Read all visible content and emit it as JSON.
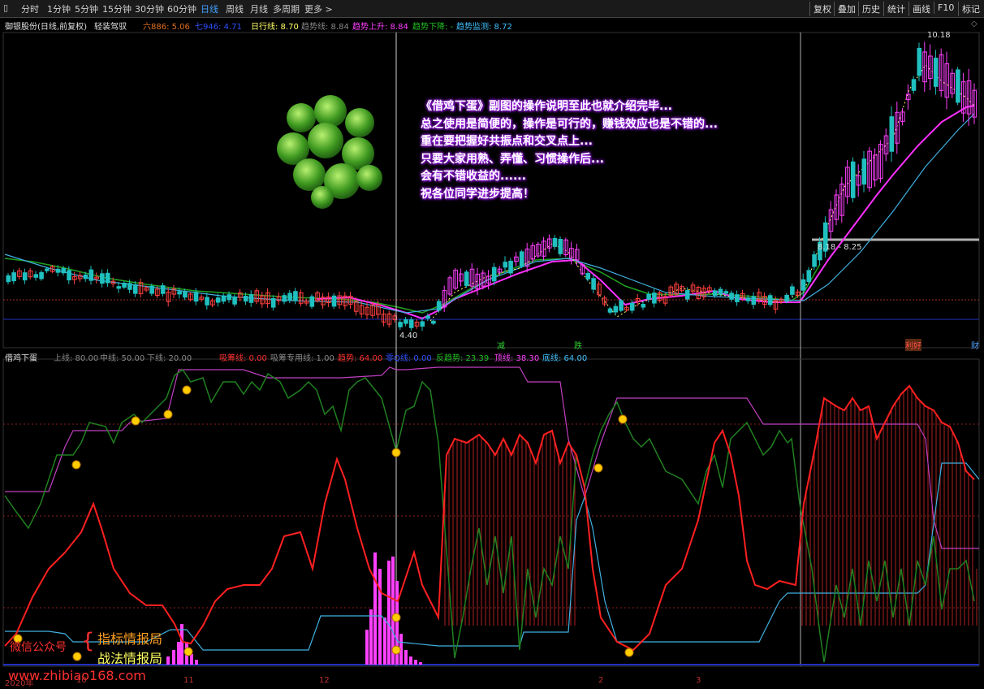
{
  "toolbar": {
    "tabs": [
      "分时",
      "1分钟",
      "5分钟",
      "15分钟",
      "30分钟",
      "60分钟",
      "日线",
      "周线",
      "月线",
      "多周期",
      "更多 >"
    ],
    "active_index": 6,
    "right_buttons": [
      "复权",
      "叠加",
      "历史",
      "统计",
      "画线",
      "F10",
      "标记"
    ]
  },
  "main_header": {
    "stock": "御银股份(日线,前复权)",
    "indicator": "轻装驾驭",
    "items": [
      {
        "text": "六886: 5.06",
        "color": "#e07020"
      },
      {
        "text": "七946: 4.71",
        "color": "#3050ff"
      },
      {
        "text": "日行线: 8.70",
        "color": "#ffff66"
      },
      {
        "text": "趋势线: 8.84",
        "color": "#888888"
      },
      {
        "text": "趋势上升: 8.84",
        "color": "#ff40ff"
      },
      {
        "text": "趋势下降: -",
        "color": "#20c020"
      },
      {
        "text": "趋势监测: 8.72",
        "color": "#40c0ff"
      }
    ]
  },
  "main_chart": {
    "annotations": {
      "high": "10.18",
      "low": "4.40",
      "range": "8.18 - 8.25"
    },
    "marks": [
      "减",
      "跌",
      "利好",
      "财"
    ]
  },
  "message": {
    "lines": [
      "《借鸡下蛋》副图的操作说明至此也就介绍完毕...",
      "总之使用是简便的，操作是可行的，赚钱效应也是不错的...",
      "重在要把握好共振点和交叉点上...",
      "只要大家用熟、弄懂、习惯操作后...",
      "会有不错收益的......",
      "祝各位同学进步提高！"
    ]
  },
  "sub_header": {
    "indicator": "借鸡下蛋",
    "items": [
      {
        "text": "上线: 80.00",
        "color": "#888888"
      },
      {
        "text": "中线: 50.00",
        "color": "#888888"
      },
      {
        "text": "下线: 20.00",
        "color": "#888888"
      },
      {
        "text": "吸筹线: 0.00",
        "color": "#ff3030"
      },
      {
        "text": "吸筹专用线: 1.00",
        "color": "#888888"
      },
      {
        "text": "趋势: 64.00",
        "color": "#ff3030"
      },
      {
        "text": "零Q线: 0.00",
        "color": "#3050ff"
      },
      {
        "text": "反趋势: 23.39",
        "color": "#20c020"
      },
      {
        "text": "顶线: 38.30",
        "color": "#ff40ff"
      },
      {
        "text": "底线: 64.00",
        "color": "#40c0ff"
      }
    ]
  },
  "watermark": {
    "prefix": "微信公众号",
    "line1": "指标情报局",
    "line2": "战法情报局",
    "url": "www.zhibiao168.com"
  },
  "x_axis": {
    "labels": [
      "2020年",
      "10",
      "11",
      "12",
      "2",
      "3"
    ]
  },
  "colors": {
    "up": "#ff40ff",
    "down": "#20c0c0",
    "ma_green": "#20a020",
    "ma_magenta": "#ff30ff",
    "ma_blue": "#40b0e0",
    "purple_line": "#c040c0"
  }
}
